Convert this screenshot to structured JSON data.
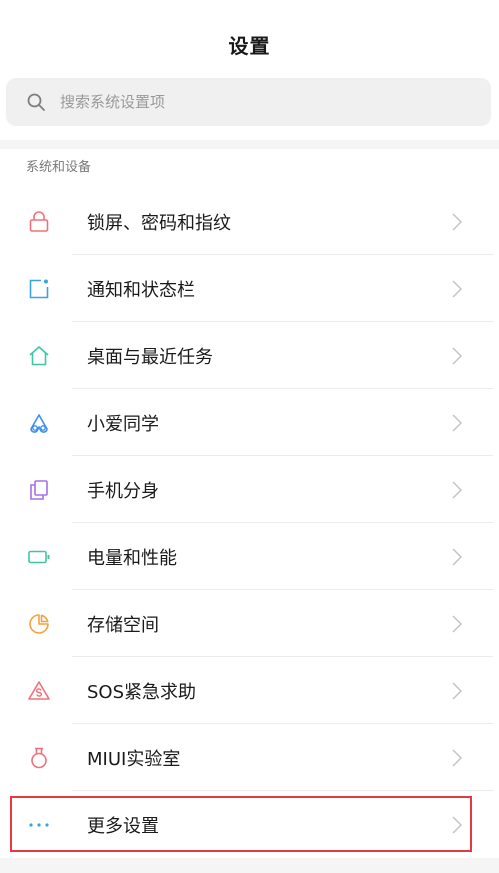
{
  "header": {
    "title": "设置"
  },
  "search": {
    "placeholder": "搜索系统设置项"
  },
  "section": {
    "title": "系统和设备"
  },
  "items": [
    {
      "label": "锁屏、密码和指纹",
      "icon": "lock-icon",
      "color": "#f0707a"
    },
    {
      "label": "通知和状态栏",
      "icon": "notification-icon",
      "color": "#3aa3e8"
    },
    {
      "label": "桌面与最近任务",
      "icon": "home-icon",
      "color": "#3ec6a6"
    },
    {
      "label": "小爱同学",
      "icon": "xiaoai-icon",
      "color": "#3b8ff0"
    },
    {
      "label": "手机分身",
      "icon": "second-space-icon",
      "color": "#a571e8"
    },
    {
      "label": "电量和性能",
      "icon": "battery-icon",
      "color": "#3ec6a6"
    },
    {
      "label": "存储空间",
      "icon": "storage-icon",
      "color": "#f5a23c"
    },
    {
      "label": "SOS紧急求助",
      "icon": "sos-icon",
      "color": "#f0707a"
    },
    {
      "label": "MIUI实验室",
      "icon": "lab-icon",
      "color": "#f0707a"
    },
    {
      "label": "更多设置",
      "icon": "more-icon",
      "color": "#3aa3e8"
    }
  ],
  "colors": {
    "highlight": "#e8373f",
    "chevron": "#c4c4c4"
  }
}
